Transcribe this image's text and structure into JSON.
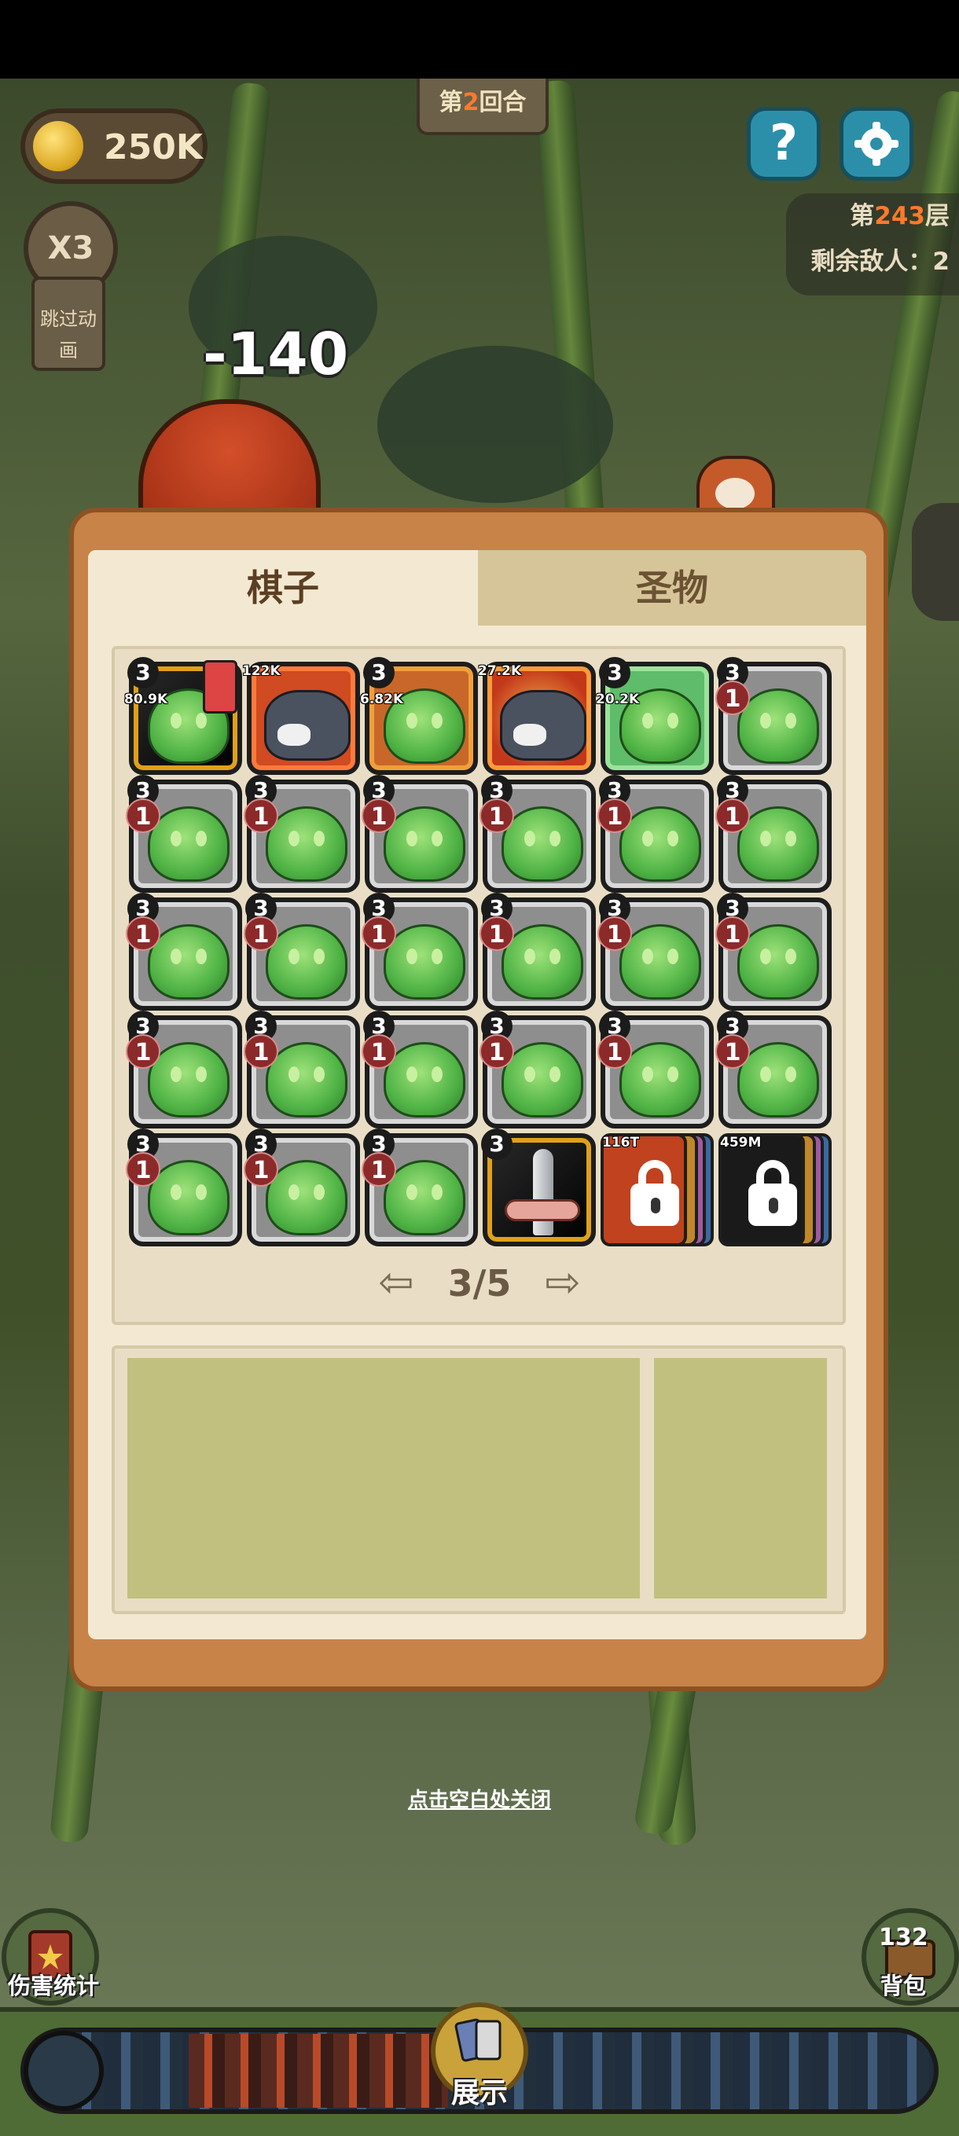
{
  "hud": {
    "coins": "250K",
    "round_prefix": "第",
    "round_number": "2",
    "round_suffix": "回合",
    "help_label": "?",
    "speed_label": "X3",
    "skip_label_line1": "跳过动",
    "skip_label_line2": "画",
    "floor_prefix": "第",
    "floor_number": "243",
    "floor_suffix": "层",
    "enemies_label": "剩余敌人：2",
    "damage_popup": "-140"
  },
  "panel": {
    "tabs": [
      {
        "label": "棋子",
        "active": true
      },
      {
        "label": "圣物",
        "active": false
      }
    ],
    "pager": {
      "text": "3/5"
    },
    "close_hint": "点击空白处关闭"
  },
  "pieces": [
    {
      "level": "3",
      "kind": "slime",
      "frame": "dark",
      "tag": "80.9K",
      "extra": "mini-card"
    },
    {
      "level": "",
      "kind": "wolf",
      "frame": "red",
      "tag": "122K"
    },
    {
      "level": "3",
      "kind": "slime",
      "frame": "orange",
      "tag": "6.82K"
    },
    {
      "level": "",
      "kind": "wolf",
      "frame": "redorange",
      "tag": "27.2K"
    },
    {
      "level": "3",
      "kind": "slime",
      "frame": "green",
      "tag": "20.2K"
    },
    {
      "level": "3",
      "kind": "slime",
      "frame": "gray",
      "star": "1"
    },
    {
      "level": "3",
      "kind": "slime",
      "frame": "gray",
      "star": "1"
    },
    {
      "level": "3",
      "kind": "slime",
      "frame": "gray",
      "star": "1"
    },
    {
      "level": "3",
      "kind": "slime",
      "frame": "gray",
      "star": "1"
    },
    {
      "level": "3",
      "kind": "slime",
      "frame": "gray",
      "star": "1"
    },
    {
      "level": "3",
      "kind": "slime",
      "frame": "gray",
      "star": "1"
    },
    {
      "level": "3",
      "kind": "slime",
      "frame": "gray",
      "star": "1"
    },
    {
      "level": "3",
      "kind": "slime",
      "frame": "gray",
      "star": "1"
    },
    {
      "level": "3",
      "kind": "slime",
      "frame": "gray",
      "star": "1"
    },
    {
      "level": "3",
      "kind": "slime",
      "frame": "gray",
      "star": "1"
    },
    {
      "level": "3",
      "kind": "slime",
      "frame": "gray",
      "star": "1"
    },
    {
      "level": "3",
      "kind": "slime",
      "frame": "gray",
      "star": "1"
    },
    {
      "level": "3",
      "kind": "slime",
      "frame": "gray",
      "star": "1"
    },
    {
      "level": "3",
      "kind": "slime",
      "frame": "gray",
      "star": "1"
    },
    {
      "level": "3",
      "kind": "slime",
      "frame": "gray",
      "star": "1"
    },
    {
      "level": "3",
      "kind": "slime",
      "frame": "gray",
      "star": "1"
    },
    {
      "level": "3",
      "kind": "slime",
      "frame": "gray",
      "star": "1"
    },
    {
      "level": "3",
      "kind": "slime",
      "frame": "gray",
      "star": "1"
    },
    {
      "level": "3",
      "kind": "slime",
      "frame": "gray",
      "star": "1"
    },
    {
      "level": "3",
      "kind": "slime",
      "frame": "gray",
      "star": "1"
    },
    {
      "level": "3",
      "kind": "slime",
      "frame": "gray",
      "star": "1"
    },
    {
      "level": "3",
      "kind": "slime",
      "frame": "gray",
      "star": "1"
    },
    {
      "level": "3",
      "kind": "sword",
      "frame": "dark"
    },
    {
      "level": "",
      "kind": "locked",
      "frame": "red",
      "tag": "116T"
    },
    {
      "level": "",
      "kind": "locked",
      "frame": "dark",
      "tag": "459M"
    }
  ],
  "bottom": {
    "damage_stats_label": "伤害统计",
    "bag_count": "132",
    "bag_label": "背包",
    "show_label": "展示"
  },
  "colors": {
    "panel_frame": "#c88348",
    "panel_inner": "#f3e9d2",
    "highlight": "#ff7a2a",
    "help_button": "#2c8fa9"
  }
}
